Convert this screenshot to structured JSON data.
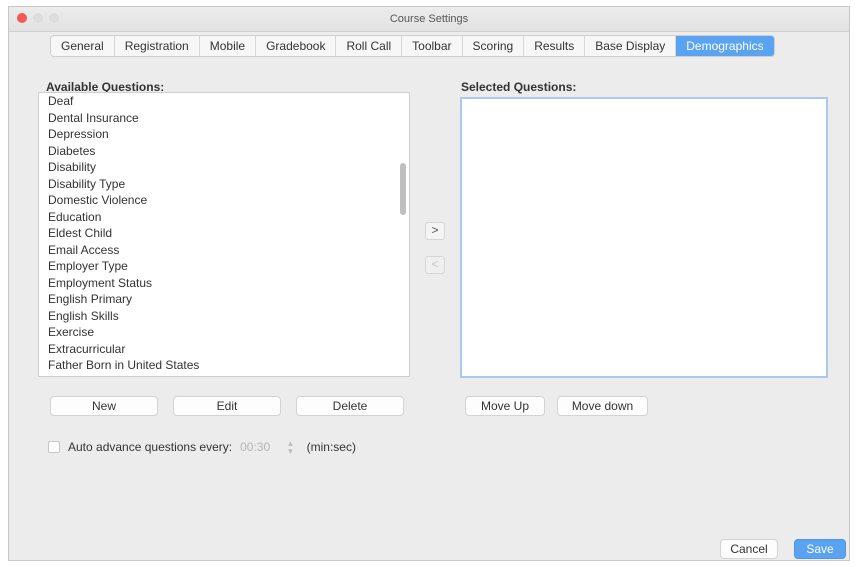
{
  "window": {
    "title": "Course Settings"
  },
  "tabs": [
    {
      "label": "General"
    },
    {
      "label": "Registration"
    },
    {
      "label": "Mobile"
    },
    {
      "label": "Gradebook"
    },
    {
      "label": "Roll Call"
    },
    {
      "label": "Toolbar"
    },
    {
      "label": "Scoring"
    },
    {
      "label": "Results"
    },
    {
      "label": "Base Display"
    },
    {
      "label": "Demographics",
      "active": true
    }
  ],
  "available": {
    "heading": "Available Questions:",
    "items": [
      "Deaf",
      "Dental Insurance",
      "Depression",
      "Diabetes",
      "Disability",
      "Disability Type",
      "Domestic Violence",
      "Education",
      "Eldest Child",
      "Email Access",
      "Employer Type",
      "Employment Status",
      "English Primary",
      "English Skills",
      "Exercise",
      "Extracurricular",
      "Father Born in United States"
    ]
  },
  "selected": {
    "heading": "Selected Questions:",
    "items": []
  },
  "transfer": {
    "add_glyph": ">",
    "remove_glyph": "<"
  },
  "buttons": {
    "new": "New",
    "edit": "Edit",
    "delete": "Delete",
    "move_up": "Move Up",
    "move_down": "Move down",
    "cancel": "Cancel",
    "save": "Save"
  },
  "auto_advance": {
    "label": "Auto advance questions every:",
    "value": "00:30",
    "unit": "(min:sec)",
    "checked": false
  },
  "colors": {
    "accent": "#5aa3f0",
    "window_bg": "#ececec"
  }
}
